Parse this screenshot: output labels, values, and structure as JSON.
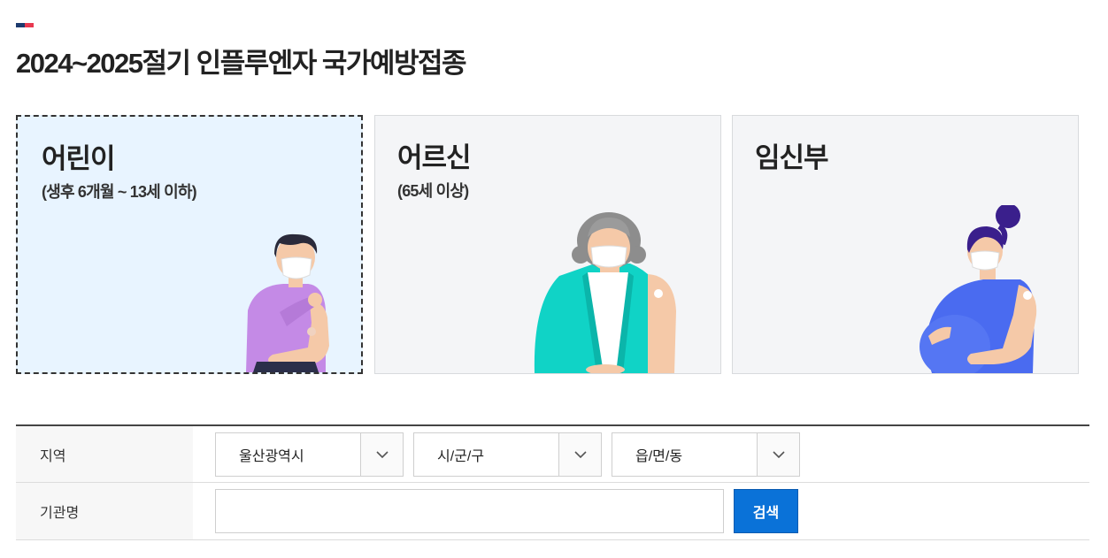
{
  "page": {
    "title": "2024~2025절기 인플루엔자 국가예방접종",
    "accent_colors": [
      "#1c3a6e",
      "#e8384f"
    ]
  },
  "cards": [
    {
      "title": "어린이",
      "subtitle": "(생후 6개월 ~ 13세 이하)",
      "selected": true,
      "icon": "child-illustration"
    },
    {
      "title": "어르신",
      "subtitle": "(65세 이상)",
      "selected": false,
      "icon": "elderly-illustration"
    },
    {
      "title": "임신부",
      "subtitle": "",
      "selected": false,
      "icon": "pregnant-woman-illustration"
    }
  ],
  "search": {
    "region_label": "지역",
    "province_value": "울산광역시",
    "city_value": "시/군/구",
    "town_value": "읍/면/동",
    "institution_label": "기관명",
    "institution_value": "",
    "institution_placeholder": "",
    "search_button": "검색",
    "button_color": "#0a72d8"
  }
}
